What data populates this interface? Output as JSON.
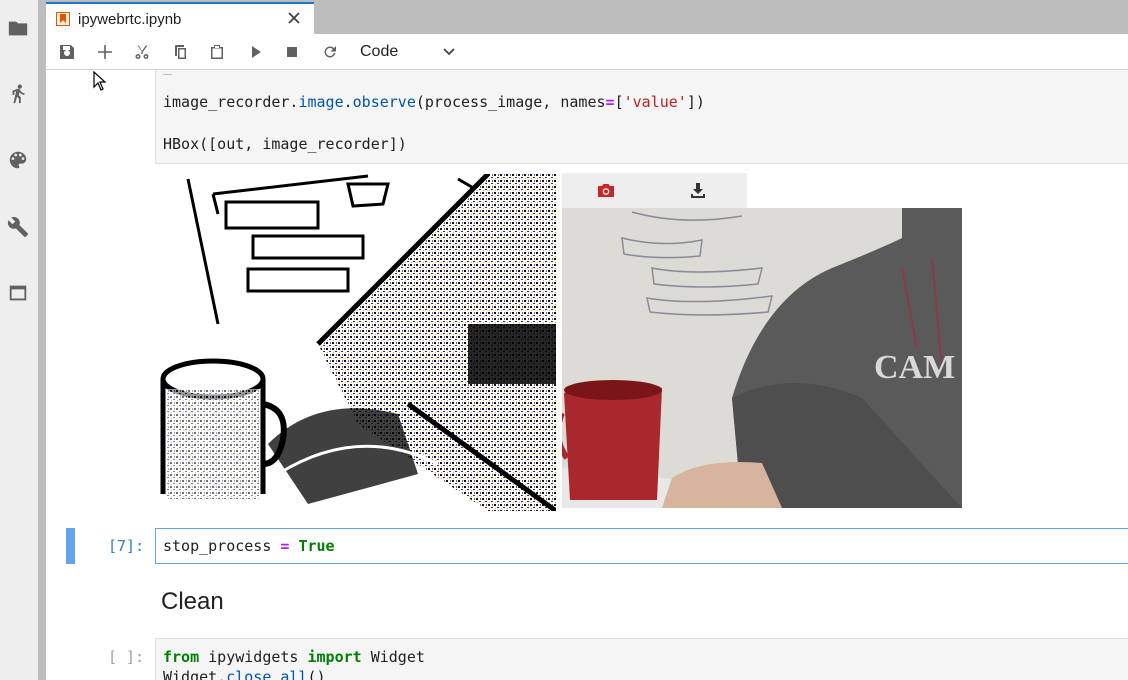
{
  "tab": {
    "title": "ipywebrtc.ipynb"
  },
  "toolbar": {
    "cell_type": "Code"
  },
  "activity_icons": [
    "folder-icon",
    "running-icon",
    "palette-icon",
    "wrench-icon",
    "tabs-icon"
  ],
  "cells": {
    "cell1": {
      "line1_a": "image_recorder.",
      "line1_b": "image",
      "line1_c": ".",
      "line1_d": "observe",
      "line1_e": "(process_image, names",
      "line1_f": "=",
      "line1_g": "[",
      "line1_h": "'value'",
      "line1_i": "])",
      "line2": "HBox([out, image_recorder])"
    },
    "cell7": {
      "prompt": "[7]:",
      "code_a": "stop_process ",
      "code_b": "=",
      "code_c": " True"
    },
    "heading": "Clean",
    "cell_last": {
      "prompt": "[ ]:",
      "line1_kw1": "from",
      "line1_mod": " ipywidgets ",
      "line1_kw2": "import",
      "line1_name": " Widget",
      "line2_a": "Widget.",
      "line2_b": "close_all",
      "line2_c": "()"
    }
  },
  "colors": {
    "accent": "#1976d2",
    "active_cell": "#64a2eb",
    "prompt_active": "#307fc1",
    "camera_icon": "#c62828"
  }
}
